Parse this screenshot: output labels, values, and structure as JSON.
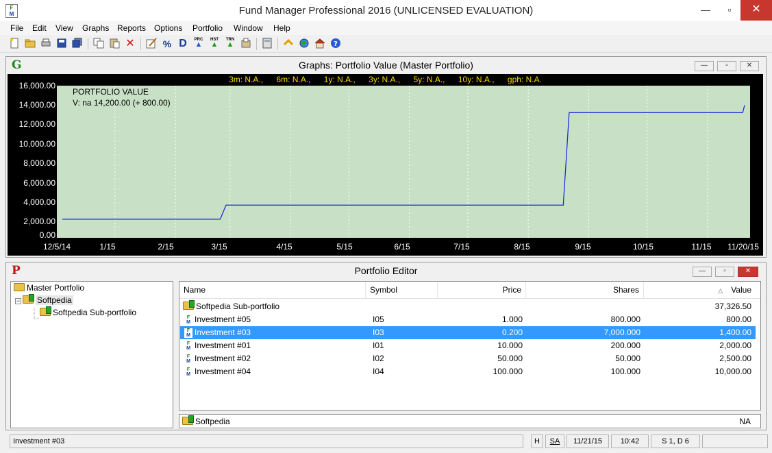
{
  "window": {
    "title": "Fund Manager Professional 2016 (UNLICENSED EVALUATION)",
    "icon_letters": [
      "F",
      "M"
    ],
    "min_glyph": "—",
    "max_glyph": "▫",
    "close_glyph": "✕"
  },
  "menu": {
    "items": [
      "File",
      "Edit",
      "View",
      "Graphs",
      "Reports",
      "Options",
      "Portfolio",
      "Window",
      "Help"
    ]
  },
  "toolbar": {
    "percent_label": "%",
    "d_label": "D",
    "prc_label": "PRC",
    "hst_label": "HST",
    "trn_label": "TRN",
    "icons": [
      "new-icon",
      "open-icon",
      "print-icon",
      "save-icon",
      "save-all-icon",
      "copy-icon",
      "paste-icon",
      "delete-icon",
      "edit-icon",
      "percent-icon",
      "dividend-icon",
      "prices-icon",
      "history-icon",
      "transactions-icon",
      "import-icon",
      "calculator-icon",
      "refresh-icon",
      "web-icon",
      "home-icon",
      "help-icon"
    ]
  },
  "graph_window": {
    "letter": "G",
    "title": "Graphs: Portfolio Value (Master Portfolio)",
    "stats": [
      "3m: N.A.,",
      "6m: N.A.,",
      "1y: N.A.,",
      "3y: N.A.,",
      "5y: N.A.,",
      "10y: N.A.,",
      "gph: N.A."
    ],
    "legend_title": "PORTFOLIO VALUE",
    "legend_value": "V: na 14,200.00 (+ 800.00)",
    "colors": {
      "plot_bg": "#c8e0c6",
      "line": "#1c2ee0",
      "stats": "#ffd700"
    }
  },
  "chart_data": {
    "type": "line",
    "title": "PORTFOLIO VALUE",
    "xlabel": "",
    "ylabel": "",
    "x_tick_labels": [
      "12/5/14",
      "1/15",
      "2/15",
      "3/15",
      "4/15",
      "5/15",
      "6/15",
      "7/15",
      "8/15",
      "9/15",
      "10/15",
      "11/15",
      "11/20/15"
    ],
    "y_tick_labels": [
      "16,000.00",
      "14,000.00",
      "12,000.00",
      "10,000.00",
      "8,000.00",
      "6,000.00",
      "4,000.00",
      "2,000.00",
      "0.00"
    ],
    "ylim": [
      0,
      16000
    ],
    "xlim": [
      "2014-12-05",
      "2015-11-20"
    ],
    "grid": true,
    "series": [
      {
        "x": [
          "2014-12-05",
          "2015-02-24",
          "2015-02-27",
          "2015-08-19",
          "2015-08-22",
          "2015-11-19",
          "2015-11-20"
        ],
        "y": [
          2000,
          2000,
          3500,
          3500,
          13400,
          13400,
          14200
        ]
      }
    ]
  },
  "editor_window": {
    "letter": "P",
    "title": "Portfolio Editor",
    "tree": {
      "toggle": "−",
      "items": [
        {
          "label": "Master Portfolio"
        },
        {
          "label": "Softpedia"
        },
        {
          "label": "Softpedia Sub-portfolio"
        }
      ]
    },
    "grid": {
      "headers": [
        "Name",
        "Symbol",
        "Price",
        "Shares",
        "Value"
      ],
      "sort_glyph": "△",
      "rows": [
        {
          "name": "Softpedia Sub-portfolio",
          "symbol": "",
          "price": "",
          "shares": "",
          "value": "37,326.50",
          "kind": "folder"
        },
        {
          "name": "Investment #05",
          "symbol": "I05",
          "price": "1.000",
          "shares": "800.000",
          "value": "800.00",
          "kind": "fund"
        },
        {
          "name": "Investment #03",
          "symbol": "I03",
          "price": "0.200",
          "shares": "7,000.000",
          "value": "1,400.00",
          "kind": "fund",
          "selected": true
        },
        {
          "name": "Investment #01",
          "symbol": "I01",
          "price": "10.000",
          "shares": "200.000",
          "value": "2,000.00",
          "kind": "fund"
        },
        {
          "name": "Investment #02",
          "symbol": "I02",
          "price": "50.000",
          "shares": "50.000",
          "value": "2,500.00",
          "kind": "fund"
        },
        {
          "name": "Investment #04",
          "symbol": "I04",
          "price": "100.000",
          "shares": "100.000",
          "value": "10,000.00",
          "kind": "fund"
        }
      ]
    },
    "summary": {
      "name": "Softpedia",
      "value": "NA"
    }
  },
  "status": {
    "text": "Investment #03",
    "h": "H",
    "sa": "SA",
    "date": "11/21/15",
    "time": "10:42",
    "sd": "S 1, D 6"
  }
}
